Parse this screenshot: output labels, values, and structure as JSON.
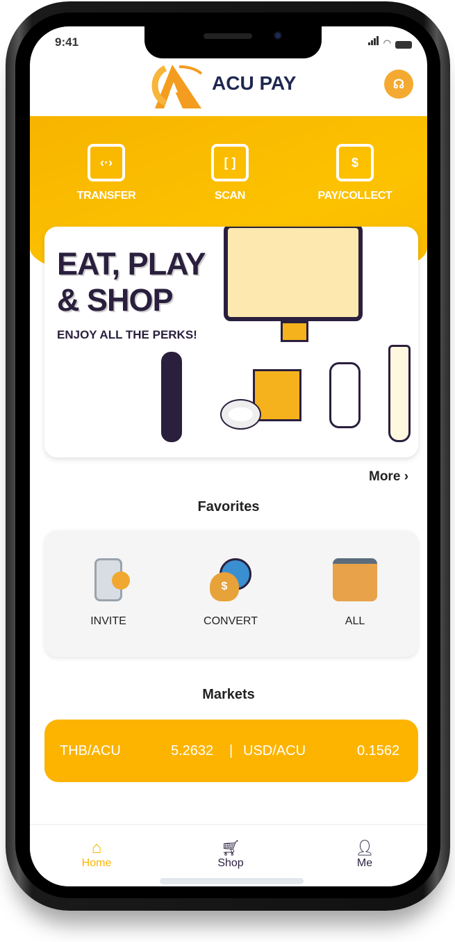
{
  "status_bar": {
    "time": "9:41"
  },
  "header": {
    "title": "ACU PAY",
    "support_icon": "headset-icon"
  },
  "actions": [
    {
      "label": "TRANSFER",
      "icon": "phone-transfer-icon"
    },
    {
      "label": "SCAN",
      "icon": "scan-phone-icon"
    },
    {
      "label": "PAY/COLLECT",
      "icon": "dollar-phone-icon"
    }
  ],
  "banner": {
    "line1": "EAT, PLAY",
    "line2": "& SHOP",
    "subtitle": "ENJOY ALL THE PERKS!"
  },
  "more_label": "More",
  "favorites": {
    "title": "Favorites",
    "items": [
      {
        "label": "INVITE",
        "icon": "phone-lock-icon"
      },
      {
        "label": "CONVERT",
        "icon": "money-bag-clock-icon"
      },
      {
        "label": "ALL",
        "icon": "backpack-icon"
      }
    ]
  },
  "markets": {
    "title": "Markets",
    "pair1": "THB/ACU",
    "value1": "5.2632",
    "separator": "|",
    "pair2": "USD/ACU",
    "value2": "0.1562"
  },
  "nav": {
    "items": [
      {
        "label": "Home",
        "active": true
      },
      {
        "label": "Shop"
      },
      {
        "label": "Me"
      }
    ]
  },
  "colors": {
    "accent": "#fcb400",
    "active_nav": "#fcb400",
    "text_dark": "#1f2850"
  }
}
